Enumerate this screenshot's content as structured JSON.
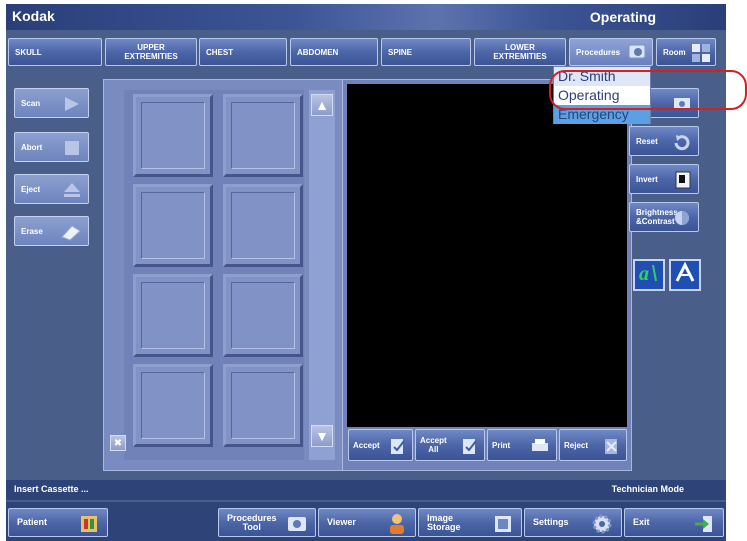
{
  "app": {
    "brand": "Kodak",
    "room": "Operating"
  },
  "categories": [
    {
      "label": "SKULL"
    },
    {
      "label": "UPPER\nEXTREMITIES"
    },
    {
      "label": "CHEST"
    },
    {
      "label": "ABDOMEN"
    },
    {
      "label": "SPINE"
    },
    {
      "label": "LOWER\nEXTREMITIES"
    }
  ],
  "top_actions": {
    "procedures": "Procedures",
    "room": "Room"
  },
  "left_buttons": {
    "scan": "Scan",
    "abort": "Abort",
    "eject": "Eject",
    "erase": "Erase"
  },
  "viewer_buttons": {
    "accept": "Accept",
    "accept_all": "Accept\nAll",
    "print": "Print",
    "reject": "Reject"
  },
  "right_buttons": {
    "reset": "Reset",
    "invert": "Invert",
    "brightness": "Brightness\n&Contrast"
  },
  "dropdown": {
    "items": [
      "Dr. Smith",
      "Operating",
      "Emergency"
    ]
  },
  "status": {
    "left": "Insert Cassette ...",
    "right": "Technician Mode"
  },
  "taskbar": {
    "patient": "Patient",
    "procedures_tool": "Procedures\nTool",
    "viewer": "Viewer",
    "image_storage": "Image\nStorage",
    "settings": "Settings",
    "exit": "Exit"
  },
  "colors": {
    "accent": "#4d66a8",
    "dropdown_highlight": "#5ba0e2",
    "callout": "#d61f1f"
  }
}
